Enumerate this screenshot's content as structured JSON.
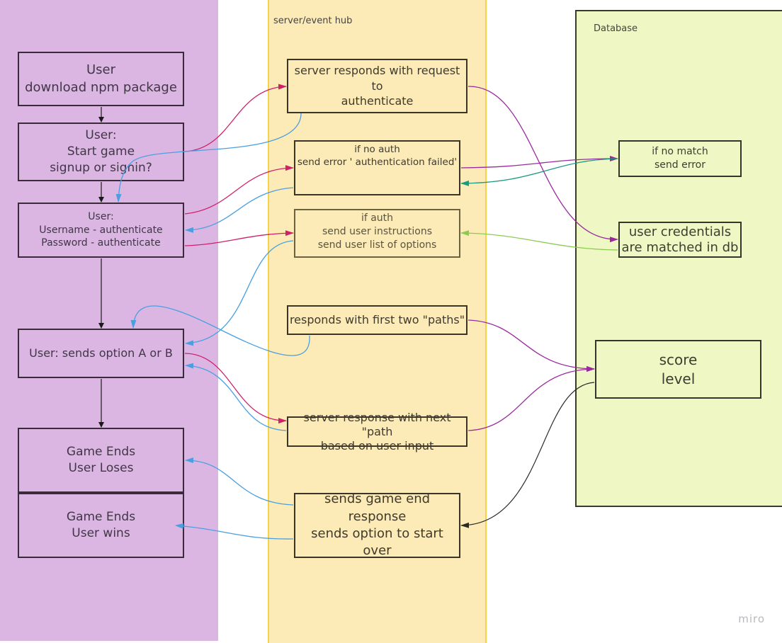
{
  "lanes": {
    "user": {
      "title": "",
      "color": "#dcb6e3"
    },
    "server": {
      "title": "server/event hub",
      "color": "#fcebb6"
    },
    "database": {
      "title": "Database",
      "color": "#eff7c4"
    }
  },
  "user_boxes": {
    "download": "User\ndownload npm package",
    "start": "User:\nStart game\nsignup or signin?",
    "auth": "User:\nUsername - authenticate\nPassword - authenticate",
    "option": "User: sends option A or B",
    "loses": "Game Ends\nUser Loses",
    "wins": "Game Ends\nUser wins"
  },
  "server_boxes": {
    "request_auth": "server responds with request to\nauthenticate",
    "no_auth": "if no auth\nsend error ' authentication failed'",
    "auth_ok": "if auth\nsend user instructions\nsend user list of options",
    "first_paths": "responds with first two \"paths\"",
    "next_path": "server response with next \"path\nbased on user input",
    "game_end": "sends game end response\nsends option to start over"
  },
  "db_boxes": {
    "no_match": "if no match\nsend error",
    "credentials": "user credentials\nare matched in db",
    "score": "score\nlevel"
  },
  "connector_colors": {
    "flow": "#1a1a1a",
    "user_to_server": "#d0206a",
    "server_to_user": "#4a9fe0",
    "server_to_db": "#9a2a9e",
    "db_to_server_error": "#1a9a80",
    "db_to_server_ok": "#8acb50",
    "db_to_server_end": "#2a2a2a"
  },
  "watermark": "miro"
}
